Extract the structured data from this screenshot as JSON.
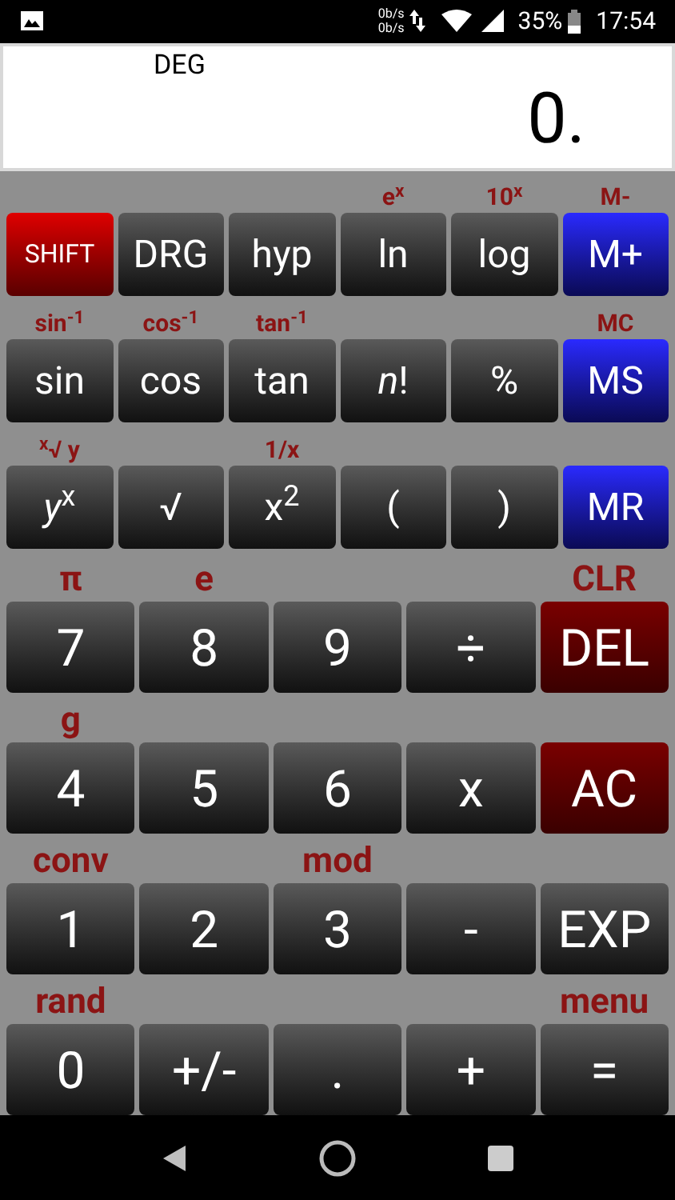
{
  "status_bar": {
    "net_up": "0b/s",
    "net_down": "0b/s",
    "battery": "35%",
    "time": "17:54"
  },
  "display": {
    "mode": "DEG",
    "value": "0."
  },
  "sci_rows": [
    [
      {
        "label": "SHIFT",
        "kind": "shift"
      },
      {
        "label": "DRG",
        "kind": "normal"
      },
      {
        "label": "hyp",
        "kind": "normal"
      },
      {
        "label": "ln",
        "shift_label": "e$^{x}$",
        "kind": "normal"
      },
      {
        "label": "log",
        "shift_label": "10$^{x}$",
        "kind": "normal"
      },
      {
        "label": "M+",
        "shift_label": "M-",
        "kind": "memory"
      }
    ],
    [
      {
        "label": "sin",
        "shift_label": "sin$^{-1}$",
        "kind": "normal"
      },
      {
        "label": "cos",
        "shift_label": "cos$^{-1}$",
        "kind": "normal"
      },
      {
        "label": "tan",
        "shift_label": "tan$^{-1}$",
        "kind": "normal"
      },
      {
        "label": "*n*!",
        "kind": "normal"
      },
      {
        "label": "%",
        "kind": "normal"
      },
      {
        "label": "MS",
        "shift_label": "MC",
        "kind": "memory"
      }
    ],
    [
      {
        "label": "*y*$^{x}$",
        "shift_label": "$^{x}$√ y",
        "kind": "normal"
      },
      {
        "label": "√",
        "kind": "normal"
      },
      {
        "label": "x$^{2}$",
        "shift_label": "1/x",
        "kind": "normal"
      },
      {
        "label": "(",
        "kind": "normal"
      },
      {
        "label": ")",
        "kind": "normal"
      },
      {
        "label": "MR",
        "kind": "memory"
      }
    ]
  ],
  "num_rows": [
    [
      {
        "label": "7",
        "shift_label": "π",
        "kind": "normal"
      },
      {
        "label": "8",
        "shift_label": "e",
        "kind": "normal"
      },
      {
        "label": "9",
        "kind": "normal"
      },
      {
        "label": "÷",
        "kind": "normal"
      },
      {
        "label": "DEL",
        "shift_label": "CLR",
        "kind": "clear"
      }
    ],
    [
      {
        "label": "4",
        "shift_label": "g",
        "kind": "normal"
      },
      {
        "label": "5",
        "kind": "normal"
      },
      {
        "label": "6",
        "kind": "normal"
      },
      {
        "label": "x",
        "kind": "normal"
      },
      {
        "label": "AC",
        "kind": "clear"
      }
    ],
    [
      {
        "label": "1",
        "shift_label": "conv",
        "kind": "normal"
      },
      {
        "label": "2",
        "kind": "normal"
      },
      {
        "label": "3",
        "shift_label": "mod",
        "kind": "normal"
      },
      {
        "label": "-",
        "kind": "normal"
      },
      {
        "label": "EXP",
        "kind": "normal"
      }
    ],
    [
      {
        "label": "0",
        "shift_label": "rand",
        "kind": "normal"
      },
      {
        "label": "+/-",
        "kind": "normal"
      },
      {
        "label": ".",
        "kind": "normal"
      },
      {
        "label": "+",
        "kind": "normal"
      },
      {
        "label": "=",
        "shift_label": "menu",
        "kind": "normal"
      }
    ]
  ]
}
